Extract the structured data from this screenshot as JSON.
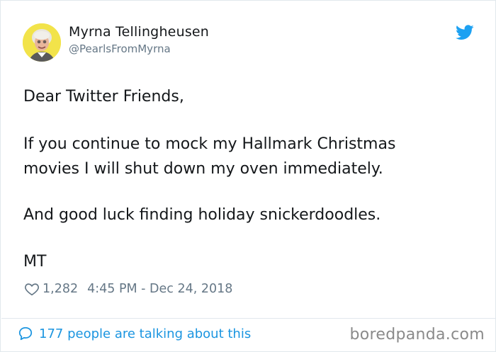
{
  "author": {
    "display_name": "Myrna Tellingheusen",
    "handle": "@PearlsFromMyrna",
    "avatar_icon": "avatar-photo"
  },
  "tweet": {
    "lines": [
      "Dear Twitter Friends,",
      "If you continue to mock my Hallmark Christmas",
      "movies I will shut down my oven immediately.",
      "And good luck finding holiday snickerdoodles.",
      "MT"
    ]
  },
  "meta": {
    "likes": "1,282",
    "timestamp": "4:45 PM - Dec 24, 2018"
  },
  "footer": {
    "talking_label": "177 people are talking about this",
    "watermark": "boredpanda.com"
  },
  "colors": {
    "twitter_blue": "#1da1f2",
    "link_blue": "#1b95e0",
    "muted_gray": "#657786",
    "border": "#e1e8ed"
  },
  "icons": {
    "brand": "twitter-bird-icon",
    "like": "heart-icon",
    "reply": "chat-bubble-icon"
  }
}
